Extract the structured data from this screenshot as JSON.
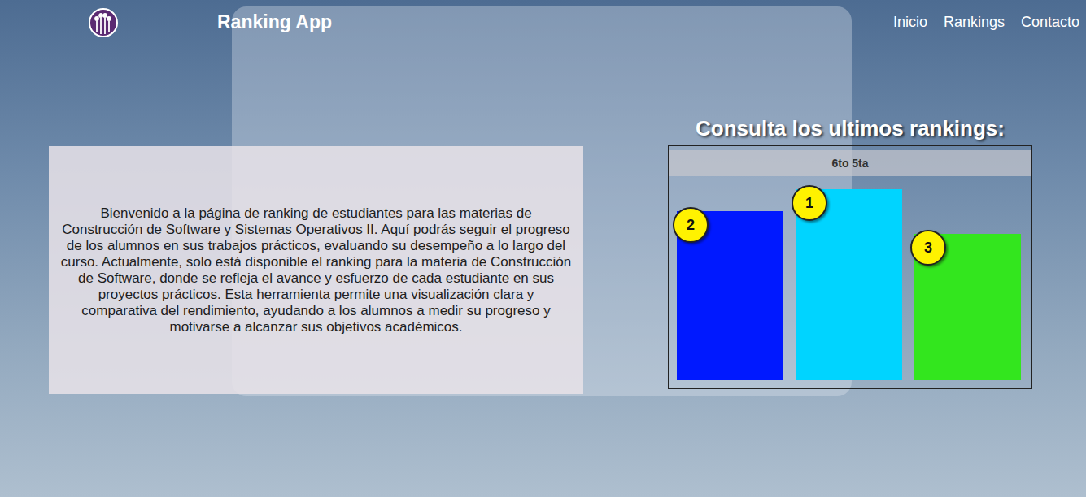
{
  "header": {
    "title": "Ranking App",
    "nav": [
      {
        "label": "Inicio"
      },
      {
        "label": "Rankings"
      },
      {
        "label": "Contacto"
      }
    ]
  },
  "intro": {
    "text": "Bienvenido a la página de ranking de estudiantes para las materias de Construcción de Software y Sistemas Operativos II. Aquí podrás seguir el progreso de los alumnos en sus trabajos prácticos, evaluando su desempeño a lo largo del curso. Actualmente, solo está disponible el ranking para la materia de Construcción de Software, donde se refleja el avance y esfuerzo de cada estudiante en sus proyectos prácticos. Esta herramienta permite una visualización clara y comparativa del rendimiento, ayudando a los alumnos a medir su progreso y motivarse a alcanzar sus objetivos académicos."
  },
  "rankings": {
    "heading": "Consulta los ultimos rankings:",
    "chart": {
      "title": "6to 5ta",
      "bars": [
        {
          "rank": "2",
          "level": 0.83,
          "color": "#0019ff"
        },
        {
          "rank": "1",
          "level": 0.94,
          "color": "#00d4ff"
        },
        {
          "rank": "3",
          "level": 0.72,
          "color": "#33e61e"
        }
      ]
    }
  }
}
